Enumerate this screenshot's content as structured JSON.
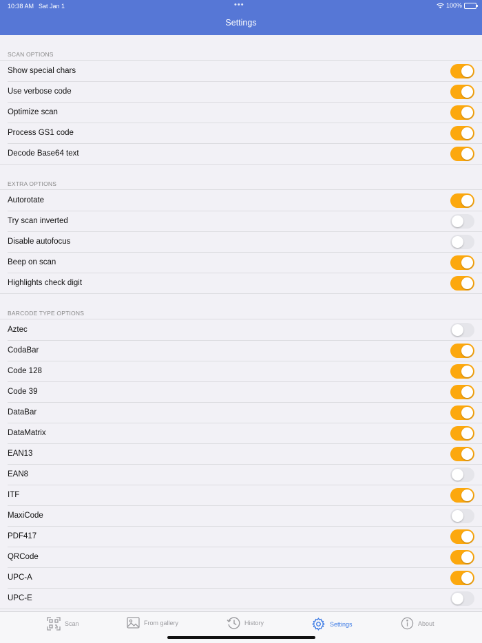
{
  "status": {
    "time": "10:38 AM",
    "date": "Sat Jan 1",
    "battery": "100%"
  },
  "header": {
    "title": "Settings"
  },
  "colors": {
    "accent": "#fca80e",
    "header": "#5677d6",
    "active_tab": "#3b7ae5"
  },
  "sections": [
    {
      "title": "SCAN OPTIONS",
      "rows": [
        {
          "label": "Show special chars",
          "on": true
        },
        {
          "label": "Use verbose code",
          "on": true
        },
        {
          "label": "Optimize scan",
          "on": true
        },
        {
          "label": "Process GS1 code",
          "on": true
        },
        {
          "label": "Decode Base64 text",
          "on": true
        }
      ]
    },
    {
      "title": "EXTRA OPTIONS",
      "rows": [
        {
          "label": "Autorotate",
          "on": true
        },
        {
          "label": "Try scan inverted",
          "on": false
        },
        {
          "label": "Disable autofocus",
          "on": false
        },
        {
          "label": "Beep on scan",
          "on": true
        },
        {
          "label": "Highlights check digit",
          "on": true
        }
      ]
    },
    {
      "title": "BARCODE TYPE OPTIONS",
      "rows": [
        {
          "label": "Aztec",
          "on": false
        },
        {
          "label": "CodaBar",
          "on": true
        },
        {
          "label": "Code 128",
          "on": true
        },
        {
          "label": "Code 39",
          "on": true
        },
        {
          "label": "DataBar",
          "on": true
        },
        {
          "label": "DataMatrix",
          "on": true
        },
        {
          "label": "EAN13",
          "on": true
        },
        {
          "label": "EAN8",
          "on": false
        },
        {
          "label": "ITF",
          "on": true
        },
        {
          "label": "MaxiCode",
          "on": false
        },
        {
          "label": "PDF417",
          "on": true
        },
        {
          "label": "QRCode",
          "on": true
        },
        {
          "label": "UPC-A",
          "on": true
        },
        {
          "label": "UPC-E",
          "on": false
        }
      ]
    }
  ],
  "tabbar": {
    "tabs": [
      {
        "label": "Scan",
        "icon": "qr-scan-icon",
        "active": false
      },
      {
        "label": "From gallery",
        "icon": "image-icon",
        "active": false
      },
      {
        "label": "History",
        "icon": "history-icon",
        "active": false
      },
      {
        "label": "Settings",
        "icon": "gear-icon",
        "active": true
      },
      {
        "label": "About",
        "icon": "info-icon",
        "active": false
      }
    ]
  }
}
